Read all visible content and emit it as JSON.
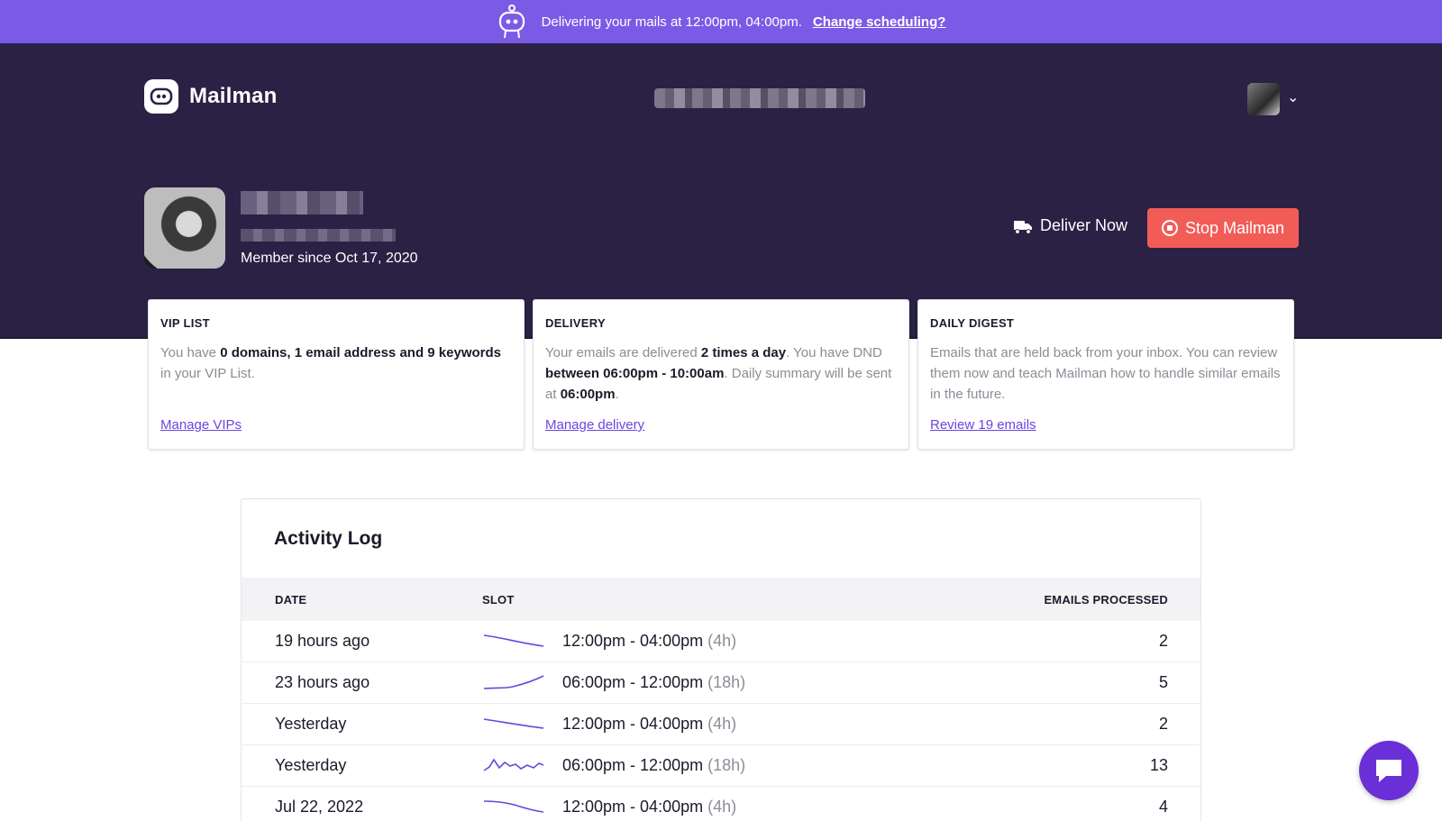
{
  "banner": {
    "message": "Delivering your mails at 12:00pm, 04:00pm.",
    "link": "Change scheduling?"
  },
  "header": {
    "app_name": "Mailman"
  },
  "profile": {
    "member_since": "Member since Oct 17, 2020"
  },
  "actions": {
    "deliver_now": "Deliver Now",
    "stop": "Stop Mailman"
  },
  "cards": [
    {
      "title": "VIP LIST",
      "body_pre": "You have ",
      "body_bold": "0 domains, 1 email address and 9 keywords",
      "body_post": " in your VIP List.",
      "link": "Manage VIPs"
    },
    {
      "title": "DELIVERY",
      "body_a": "Your emails are delivered ",
      "body_b": "2 times a day",
      "body_c": ". You have DND ",
      "body_d": "between 06:00pm - 10:00am",
      "body_e": ". Daily summary will be sent at ",
      "body_f": "06:00pm",
      "body_g": ".",
      "link": "Manage delivery"
    },
    {
      "title": "DAILY DIGEST",
      "body": "Emails that are held back from your inbox. You can review them now and teach Mailman how to handle similar emails in the future.",
      "link": "Review 19 emails"
    }
  ],
  "activity": {
    "title": "Activity Log",
    "columns": {
      "date": "DATE",
      "slot": "SLOT",
      "processed": "EMAILS PROCESSED"
    },
    "rows": [
      {
        "date": "19 hours ago",
        "slot": "12:00pm - 04:00pm",
        "duration": "(4h)",
        "count": "2"
      },
      {
        "date": "23 hours ago",
        "slot": "06:00pm - 12:00pm",
        "duration": "(18h)",
        "count": "5"
      },
      {
        "date": "Yesterday",
        "slot": "12:00pm - 04:00pm",
        "duration": "(4h)",
        "count": "2"
      },
      {
        "date": "Yesterday",
        "slot": "06:00pm - 12:00pm",
        "duration": "(18h)",
        "count": "13"
      },
      {
        "date": "Jul 22, 2022",
        "slot": "12:00pm - 04:00pm",
        "duration": "(4h)",
        "count": "4"
      }
    ]
  },
  "colors": {
    "banner": "#7b5ae6",
    "hero": "#2b2145",
    "stop": "#f25c57",
    "link": "#6a45e0",
    "sparkline": "#6a45e0"
  }
}
